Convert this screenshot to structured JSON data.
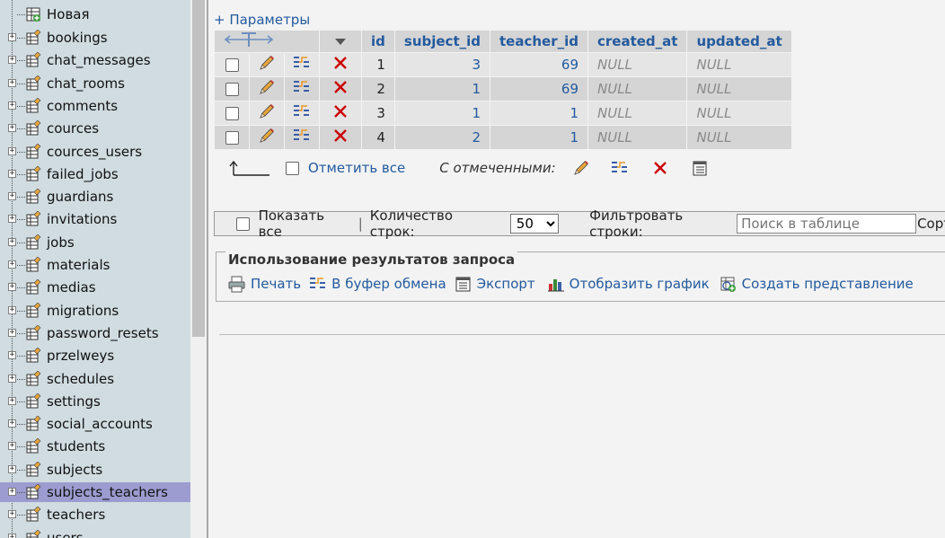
{
  "nav": {
    "new_item": "Новая",
    "tables": [
      "bookings",
      "chat_messages",
      "chat_rooms",
      "comments",
      "cources",
      "cources_users",
      "failed_jobs",
      "guardians",
      "invitations",
      "jobs",
      "materials",
      "medias",
      "migrations",
      "password_resets",
      "przelweys",
      "schedules",
      "settings",
      "social_accounts",
      "students",
      "subjects",
      "subjects_teachers",
      "teachers",
      "users"
    ],
    "selected": "subjects_teachers"
  },
  "main": {
    "params_link": "+ Параметры",
    "columns": [
      "id",
      "subject_id",
      "teacher_id",
      "created_at",
      "updated_at"
    ],
    "rows": [
      {
        "id": "1",
        "subject_id": "3",
        "teacher_id": "69",
        "created_at": "NULL",
        "updated_at": "NULL"
      },
      {
        "id": "2",
        "subject_id": "1",
        "teacher_id": "69",
        "created_at": "NULL",
        "updated_at": "NULL"
      },
      {
        "id": "3",
        "subject_id": "1",
        "teacher_id": "1",
        "created_at": "NULL",
        "updated_at": "NULL"
      },
      {
        "id": "4",
        "subject_id": "2",
        "teacher_id": "1",
        "created_at": "NULL",
        "updated_at": "NULL"
      }
    ],
    "check_all": "Отметить все",
    "with_selected": "С отмеченными:",
    "navbar": {
      "show_all": "Показать все",
      "separator": "|",
      "rows_count_label": "Количество строк:",
      "rows_count_value": "50",
      "filter_label": "Фильтровать строки:",
      "filter_placeholder": "Поиск в таблице",
      "sort_label": "Сорт"
    },
    "query_ops": {
      "legend": "Использование результатов запроса",
      "print": "Печать",
      "clipboard": "В буфер обмена",
      "export": "Экспорт",
      "chart": "Отобразить график",
      "create_view": "Создать представление"
    }
  },
  "colors": {
    "nav_bg": "#d0dce0",
    "nav_selected": "#9c9cd0",
    "link": "#235a9e",
    "delete_red": "#cc0000"
  }
}
